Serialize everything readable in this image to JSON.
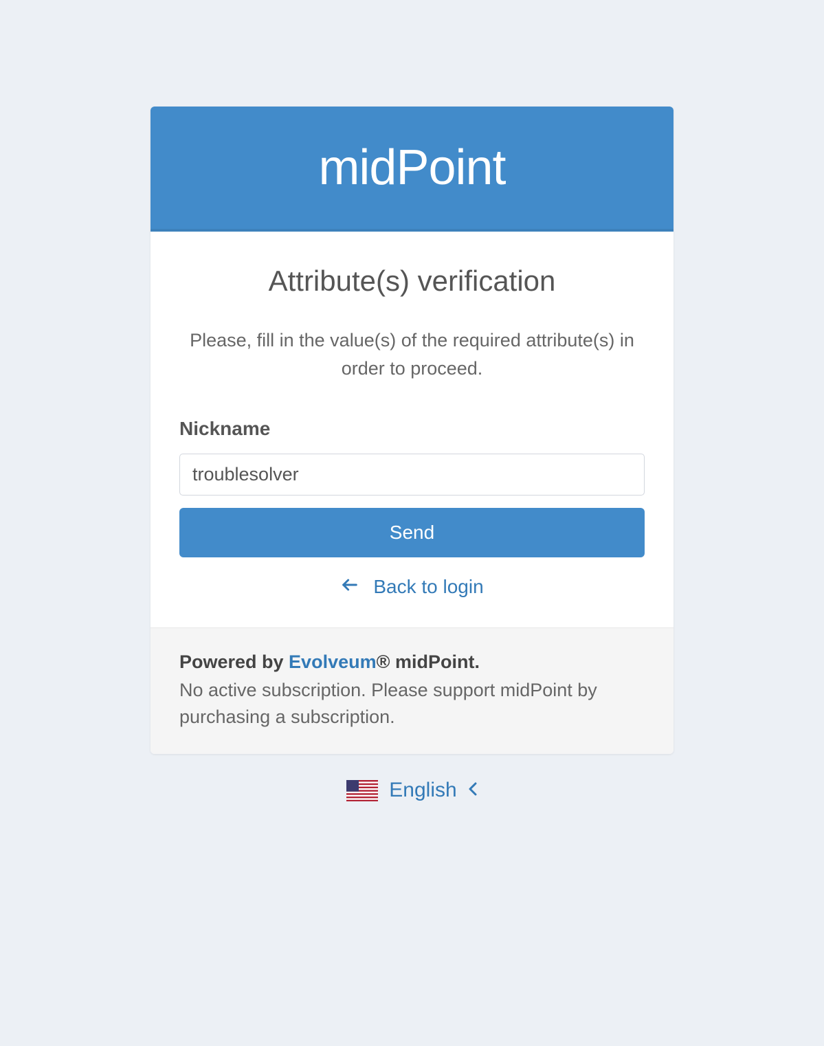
{
  "header": {
    "brand": "midPoint"
  },
  "main": {
    "title": "Attribute(s) verification",
    "description": "Please, fill in the value(s) of the required attribute(s) in order to proceed.",
    "field_label": "Nickname",
    "field_value": "troublesolver",
    "send_button": "Send",
    "back_link": "Back to login"
  },
  "footer": {
    "powered_by_prefix": "Powered by ",
    "powered_by_link": "Evolveum",
    "powered_by_suffix": "® midPoint.",
    "subscription_text": "No active subscription. Please support midPoint by purchasing a subscription."
  },
  "language": {
    "label": "English"
  }
}
